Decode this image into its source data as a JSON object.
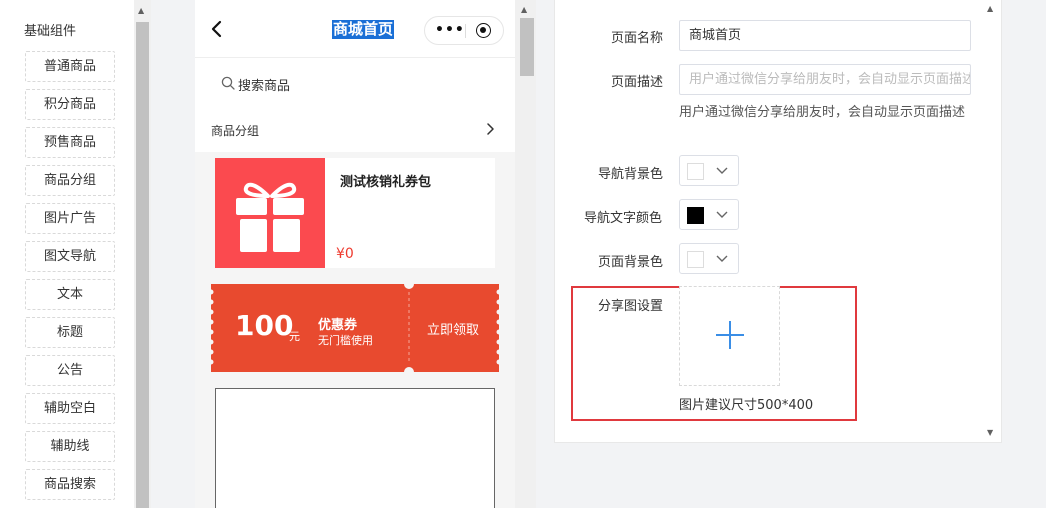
{
  "components": {
    "title": "基础组件",
    "items": [
      "普通商品",
      "积分商品",
      "预售商品",
      "商品分组",
      "图片广告",
      "图文导航",
      "文本",
      "标题",
      "公告",
      "辅助空白",
      "辅助线",
      "商品搜索"
    ]
  },
  "phone": {
    "nav_title": "商城首页",
    "more_glyph": "•••",
    "search_placeholder": "搜索商品",
    "group_label": "商品分组",
    "product": {
      "name": "测试核销礼券包",
      "price": "¥0"
    },
    "coupon": {
      "amount": "100",
      "unit": "元",
      "title": "优惠券",
      "desc": "无门槛使用",
      "action": "立即领取"
    }
  },
  "settings": {
    "page_name_label": "页面名称",
    "page_name_value": "商城首页",
    "page_desc_label": "页面描述",
    "page_desc_placeholder": "用户通过微信分享给朋友时，会自动显示页面描述",
    "page_desc_hint": "用户通过微信分享给朋友时，会自动显示页面描述",
    "nav_bg_label": "导航背景色",
    "nav_text_label": "导航文字颜色",
    "page_bg_label": "页面背景色",
    "share_image_label": "分享图设置",
    "upload_hint": "图片建议尺寸500*400"
  },
  "colors": {
    "nav_bg": "#ffffff",
    "nav_text": "#000000",
    "page_bg": "#ffffff",
    "highlight_border": "#e0393e",
    "coupon_bg": "#e84a2f",
    "product_image_bg": "#fb4a4f",
    "accent_blue": "#3a8ee6"
  },
  "icons": {
    "back": "chevron-left-icon",
    "search": "search-icon",
    "group_arrow": "chevron-right-icon",
    "gift": "gift-icon",
    "upload": "plus-icon",
    "dropdown": "chevron-down-icon"
  }
}
